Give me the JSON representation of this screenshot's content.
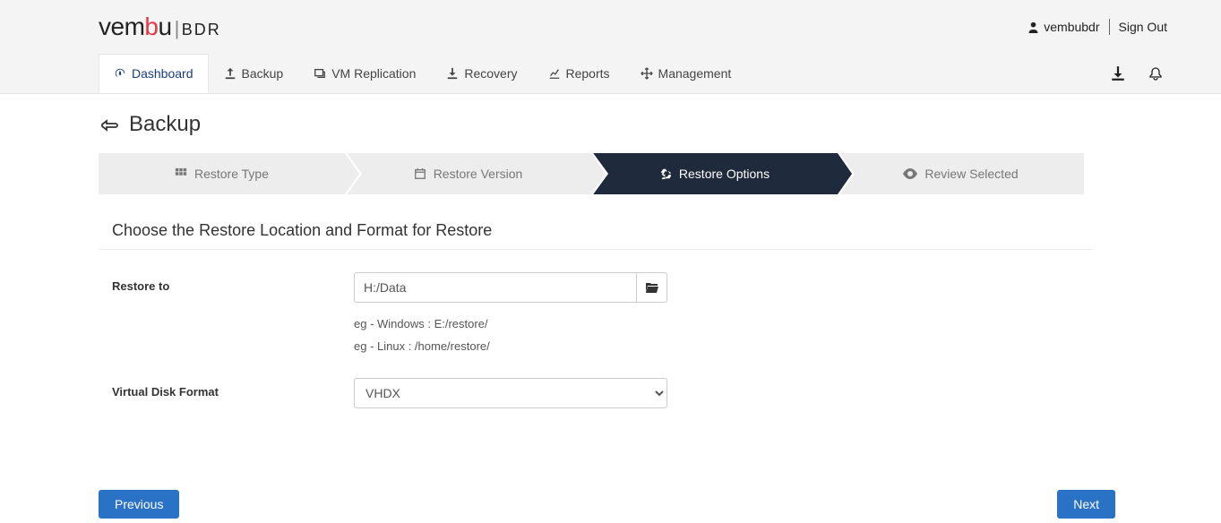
{
  "brand": {
    "text": "vembu",
    "suffix": "BDR"
  },
  "user": {
    "name": "vembubdr",
    "signout": "Sign Out"
  },
  "nav": {
    "dashboard": "Dashboard",
    "backup": "Backup",
    "vmreplication": "VM Replication",
    "recovery": "Recovery",
    "reports": "Reports",
    "management": "Management"
  },
  "page": {
    "title": "Backup",
    "section_title": "Choose the Restore Location and Format for Restore"
  },
  "steps": {
    "s1": "Restore Type",
    "s2": "Restore Version",
    "s3": "Restore Options",
    "s4": "Review Selected"
  },
  "form": {
    "restore_to_label": "Restore to",
    "restore_to_value": "H:/Data",
    "hint1": "eg - Windows : E:/restore/",
    "hint2": "eg - Linux : /home/restore/",
    "vdf_label": "Virtual Disk Format",
    "vdf_value": "VHDX"
  },
  "buttons": {
    "prev": "Previous",
    "next": "Next"
  }
}
